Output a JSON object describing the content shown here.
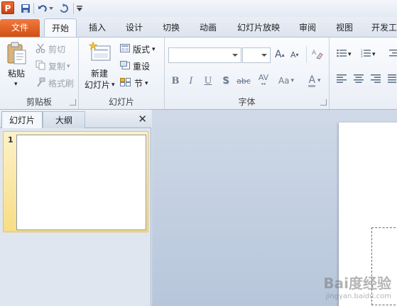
{
  "quick_access": {
    "app_letter": "P",
    "overflow": "▾"
  },
  "tabs": [
    {
      "label": "文件"
    },
    {
      "label": "开始"
    },
    {
      "label": "插入"
    },
    {
      "label": "设计"
    },
    {
      "label": "切换"
    },
    {
      "label": "动画"
    },
    {
      "label": "幻灯片放映"
    },
    {
      "label": "审阅"
    },
    {
      "label": "视图"
    },
    {
      "label": "开发工"
    }
  ],
  "ribbon": {
    "clipboard": {
      "paste": "粘贴",
      "cut": "剪切",
      "copy": "复制",
      "format_painter": "格式刷",
      "label": "剪贴板"
    },
    "slides": {
      "new_slide_line1": "新建",
      "new_slide_line2": "幻灯片",
      "layout": "版式",
      "reset": "重设",
      "section": "节",
      "label": "幻灯片"
    },
    "font": {
      "font_name": "",
      "font_size": "",
      "grow": "A",
      "shrink": "A",
      "bold": "B",
      "italic": "I",
      "underline": "U",
      "shadow": "S",
      "strike": "abc",
      "spacing": "AV",
      "case": "Aa",
      "color": "A",
      "label": "字体"
    }
  },
  "panel": {
    "tab_slides": "幻灯片",
    "tab_outline": "大纲",
    "close": "✕",
    "thumb_number": "1"
  },
  "watermark": {
    "brand": "Bai度经验",
    "site": "jingyan.baidu.com"
  },
  "colors": {
    "file_tab": "#d04f14",
    "ribbon_bg": "#f3f6fb",
    "editor_bg": "#c4d1e2",
    "selected_thumb": "#f8dd85"
  }
}
